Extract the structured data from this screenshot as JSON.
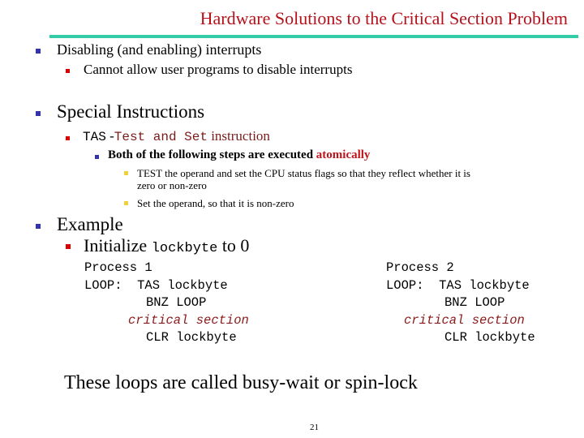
{
  "slide": {
    "title": "Hardware Solutions to the Critical Section Problem",
    "page_number": "21",
    "colors": {
      "title": "#b5121b",
      "rule": "#33cca6",
      "bullet_level1": "#3333aa",
      "bullet_level2": "#dd0000",
      "bullet_level4": "#f2d03a",
      "emphasis": "#c0141c"
    }
  },
  "bullets": {
    "b1": {
      "text": "Disabling (and enabling) interrupts",
      "sub": "Cannot allow user programs to disable interrupts"
    },
    "b2": {
      "text": "Special Instructions",
      "tas_code": "TAS",
      "tas_dash": " -",
      "tas_name": "Test and Set",
      "tas_suffix": " instruction",
      "steps_intro": "Both of the following steps are executed ",
      "steps_emphasis": "atomically",
      "step1_line1": "TEST the operand and set the CPU status flags so that they reflect whether it is",
      "step1_line2": "zero or non-zero",
      "step2": "Set the operand, so that it is non-zero"
    },
    "b3": {
      "text": "Example",
      "init_prefix": "Initialize ",
      "init_code": "lockbyte",
      "init_suffix": " to 0"
    }
  },
  "code": {
    "p1": {
      "header": "Process 1",
      "l1": "LOOP:  TAS lockbyte",
      "l2": "BNZ LOOP",
      "l3": "critical section",
      "l4": "CLR lockbyte"
    },
    "p2": {
      "header": "Process 2",
      "l1": "LOOP:  TAS lockbyte",
      "l2": "BNZ LOOP",
      "l3": "critical section",
      "l4": "CLR lockbyte"
    }
  },
  "conclusion": "These loops are called busy-wait or spin-lock"
}
